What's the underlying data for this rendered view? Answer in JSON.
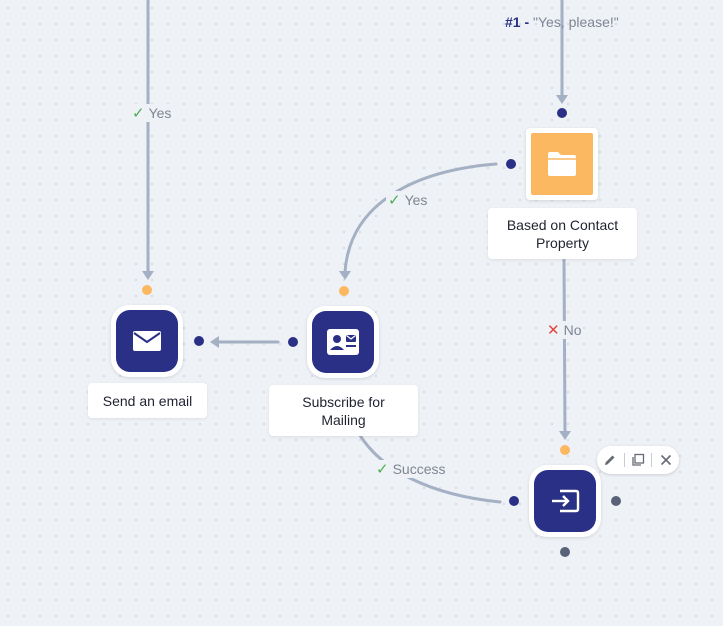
{
  "choice_label": {
    "number": "#1 -",
    "text": "\"Yes, please!\""
  },
  "edges": {
    "yes_left": "Yes",
    "yes_curve": "Yes",
    "no": "No",
    "success": "Success"
  },
  "nodes": {
    "send_email": {
      "caption": "Send an email",
      "icon": "envelope-icon"
    },
    "subscribe": {
      "caption": "Subscribe for Mailing",
      "icon": "contact-card-icon"
    },
    "condition": {
      "caption": "Based on Contact Property",
      "icon": "folder-icon"
    },
    "exit": {
      "icon": "exit-icon"
    }
  },
  "toolbar": {
    "edit": "pencil-icon",
    "duplicate": "duplicate-icon",
    "close": "close-icon"
  },
  "colors": {
    "navy": "#2b3087",
    "orange": "#fbb860",
    "connector": "#a4b0c4",
    "yes": "#4caf50",
    "no": "#e0463d"
  }
}
